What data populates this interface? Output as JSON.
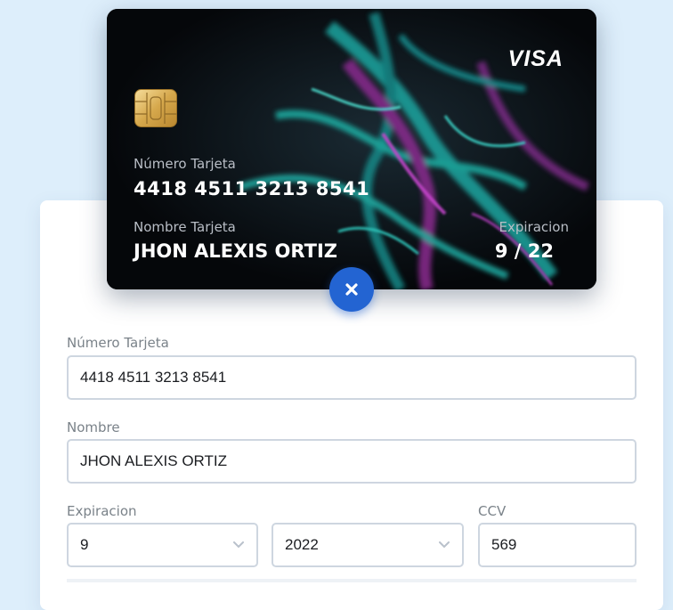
{
  "card": {
    "brand": "VISA",
    "number_label": "Número Tarjeta",
    "number": "4418 4511 3213 8541",
    "name_label": "Nombre Tarjeta",
    "name": "JHON ALEXIS ORTIZ",
    "expiry_label": "Expiracion",
    "expiry": "9 / 22"
  },
  "close_button": {
    "icon": "close-icon",
    "color": "#2364d2"
  },
  "form": {
    "card_number_label": "Número Tarjeta",
    "card_number_value": "4418 4511 3213 8541",
    "name_label": "Nombre",
    "name_value": "JHON ALEXIS ORTIZ",
    "expiry_label": "Expiracion",
    "month_value": "9",
    "year_value": "2022",
    "ccv_label": "CCV",
    "ccv_value": "569"
  },
  "colors": {
    "page_background": "#ddeefb",
    "accent": "#2364d2",
    "card_background": "#06080b",
    "input_border": "#ced6e0"
  }
}
